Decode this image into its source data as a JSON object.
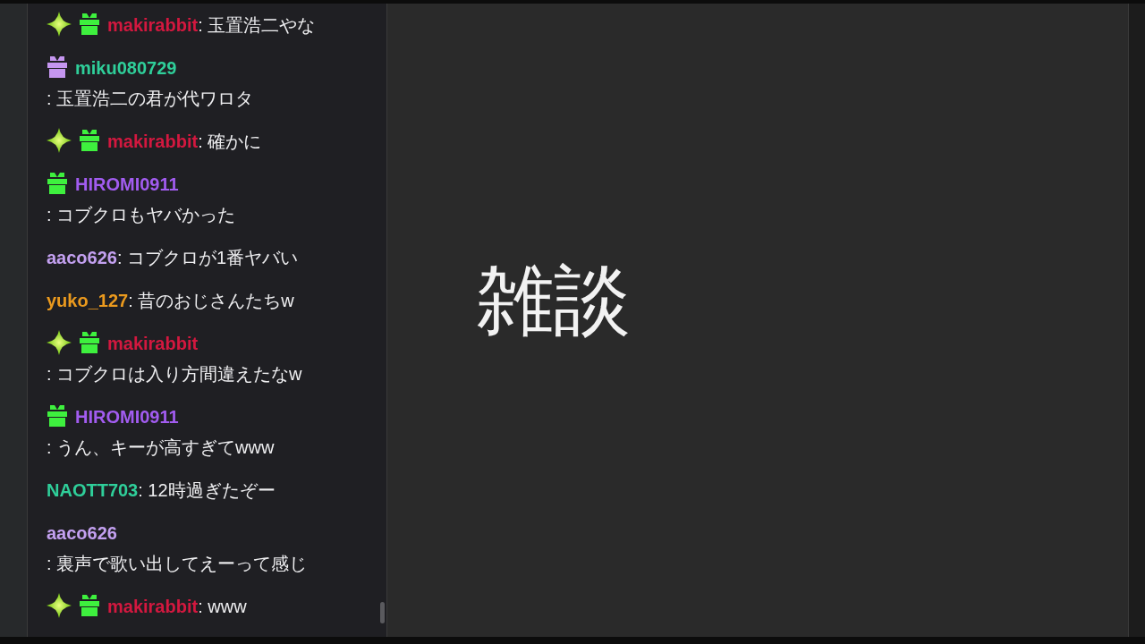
{
  "chat": {
    "messages": [
      {
        "badges": [
          {
            "kind": "sparkle"
          },
          {
            "kind": "gift",
            "color": "#3ef03e"
          }
        ],
        "username": "makirabbit",
        "color": "#d3183f",
        "text": ": 玉置浩二やな"
      },
      {
        "badges": [
          {
            "kind": "gift",
            "color": "#c596f0"
          }
        ],
        "username": "miku080729",
        "color": "#2fcf9a",
        "text": ": 玉置浩二の君が代ワロタ"
      },
      {
        "badges": [
          {
            "kind": "sparkle"
          },
          {
            "kind": "gift",
            "color": "#3ef03e"
          }
        ],
        "username": "makirabbit",
        "color": "#d3183f",
        "text": ": 確かに"
      },
      {
        "badges": [
          {
            "kind": "gift",
            "color": "#3ef03e"
          }
        ],
        "username": "HIROMI0911",
        "color": "#a25cf0",
        "text": ": コブクロもヤバかった"
      },
      {
        "username": "aaco626",
        "color": "#c3a0f0",
        "text": ": コブクロが1番ヤバい"
      },
      {
        "username": "yuko_127",
        "color": "#eb9a1e",
        "text": ": 昔のおじさんたちw"
      },
      {
        "badges": [
          {
            "kind": "sparkle"
          },
          {
            "kind": "gift",
            "color": "#3ef03e"
          }
        ],
        "username": "makirabbit",
        "color": "#d3183f",
        "text": ": コブクロは入り方間違えたなw"
      },
      {
        "badges": [
          {
            "kind": "gift",
            "color": "#3ef03e"
          }
        ],
        "username": "HIROMI0911",
        "color": "#a25cf0",
        "text": ": うん、キーが高すぎてwww"
      },
      {
        "username": "NAOTT703",
        "color": "#2fcf9a",
        "text": ": 12時過ぎたぞー"
      },
      {
        "username": "aaco626",
        "color": "#c3a0f0",
        "text": ": 裏声で歌い出してえーって感じ"
      },
      {
        "badges": [
          {
            "kind": "sparkle"
          },
          {
            "kind": "gift",
            "color": "#3ef03e"
          }
        ],
        "username": "makirabbit",
        "color": "#d3183f",
        "text": ": www"
      }
    ]
  },
  "stage": {
    "title": "雑談"
  }
}
